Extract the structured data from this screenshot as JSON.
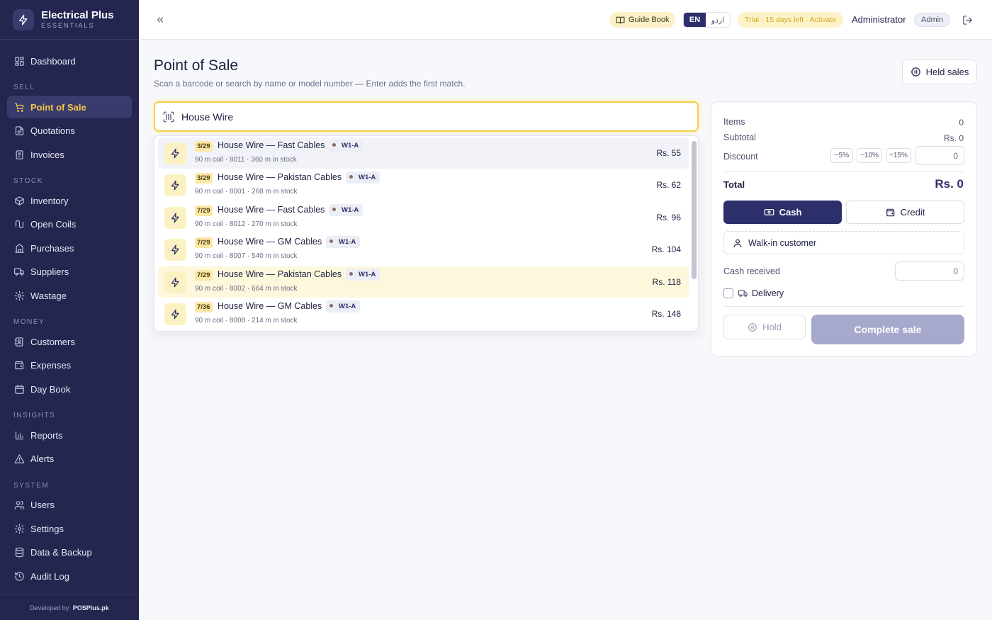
{
  "brand": {
    "title": "Electrical Plus",
    "subtitle": "ESSENTIALS"
  },
  "sidebar": {
    "sections": [
      {
        "items": [
          {
            "label": "Dashboard",
            "icon": "dashboard-icon"
          }
        ]
      },
      {
        "title": "SELL",
        "items": [
          {
            "label": "Point of Sale",
            "icon": "cart-icon",
            "active": true
          },
          {
            "label": "Quotations",
            "icon": "document-icon"
          },
          {
            "label": "Invoices",
            "icon": "invoice-icon"
          }
        ]
      },
      {
        "title": "STOCK",
        "items": [
          {
            "label": "Inventory",
            "icon": "box-icon"
          },
          {
            "label": "Open Coils",
            "icon": "coil-icon"
          },
          {
            "label": "Purchases",
            "icon": "building-icon"
          },
          {
            "label": "Suppliers",
            "icon": "truck-icon"
          },
          {
            "label": "Wastage",
            "icon": "gear-icon"
          }
        ]
      },
      {
        "title": "MONEY",
        "items": [
          {
            "label": "Customers",
            "icon": "contacts-icon"
          },
          {
            "label": "Expenses",
            "icon": "wallet-icon"
          },
          {
            "label": "Day Book",
            "icon": "calendar-icon"
          }
        ]
      },
      {
        "title": "INSIGHTS",
        "items": [
          {
            "label": "Reports",
            "icon": "bar-chart-icon"
          },
          {
            "label": "Alerts",
            "icon": "alert-icon"
          }
        ]
      },
      {
        "title": "SYSTEM",
        "items": [
          {
            "label": "Users",
            "icon": "users-icon"
          },
          {
            "label": "Settings",
            "icon": "gear-icon"
          },
          {
            "label": "Data & Backup",
            "icon": "database-icon"
          },
          {
            "label": "Audit Log",
            "icon": "history-icon"
          }
        ]
      }
    ],
    "footer": {
      "prefix": "Developed by:",
      "company": "POSPlus.pk"
    }
  },
  "topbar": {
    "guide_label": "Guide Book",
    "lang_en": "EN",
    "lang_ur": "اردو",
    "trial_text": "Trial · 15 days left · Activate",
    "user_name": "Administrator",
    "role": "Admin"
  },
  "page": {
    "title": "Point of Sale",
    "subtitle": "Scan a barcode or search by name or model number — Enter adds the first match.",
    "held_sales_label": "Held sales"
  },
  "search": {
    "value": "House Wire"
  },
  "results": [
    {
      "badge": "3/29",
      "name": "House Wire — Fast Cables",
      "location": "W1-A",
      "meta": "90 m coil · 8011 · 360 m in stock",
      "price": "Rs. 55"
    },
    {
      "badge": "3/29",
      "name": "House Wire — Pakistan Cables",
      "location": "W1-A",
      "meta": "90 m coil · 8001 · 268 m in stock",
      "price": "Rs. 62"
    },
    {
      "badge": "7/29",
      "name": "House Wire — Fast Cables",
      "location": "W1-A",
      "meta": "90 m coil · 8012 · 270 m in stock",
      "price": "Rs. 96"
    },
    {
      "badge": "7/29",
      "name": "House Wire — GM Cables",
      "location": "W1-A",
      "meta": "90 m coil · 8007 · 540 m in stock",
      "price": "Rs. 104"
    },
    {
      "badge": "7/29",
      "name": "House Wire — Pakistan Cables",
      "location": "W1-A",
      "meta": "90 m coil · 8002 · 664 m in stock",
      "price": "Rs. 118"
    },
    {
      "badge": "7/36",
      "name": "House Wire — GM Cables",
      "location": "W1-A",
      "meta": "90 m coil · 8008 · 214 m in stock",
      "price": "Rs. 148"
    }
  ],
  "cart": {
    "items_label": "Items",
    "items_value": "0",
    "subtotal_label": "Subtotal",
    "subtotal_value": "Rs. 0",
    "discount_label": "Discount",
    "discount_chips": [
      "−5%",
      "−10%",
      "−15%"
    ],
    "discount_placeholder": "0",
    "total_label": "Total",
    "total_value": "Rs. 0",
    "cash_label": "Cash",
    "credit_label": "Credit",
    "customer_label": "Walk-in customer",
    "cash_received_label": "Cash received",
    "cash_received_placeholder": "0",
    "delivery_label": "Delivery",
    "hold_label": "Hold",
    "complete_label": "Complete sale"
  },
  "colors": {
    "sidebar_bg": "#24264f",
    "accent": "#f5c84a",
    "primary": "#2d2f6b"
  }
}
